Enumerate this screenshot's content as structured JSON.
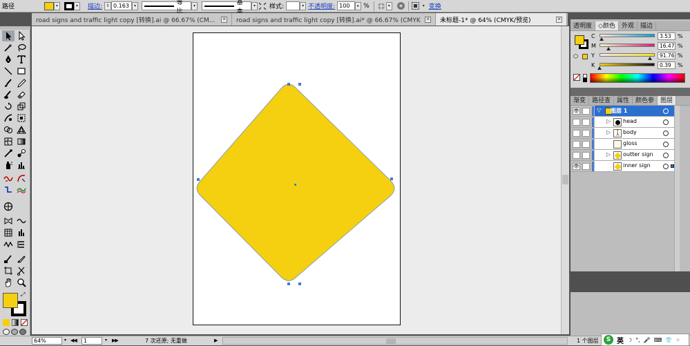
{
  "control_bar": {
    "object_type": "路径",
    "stroke_label": "描边:",
    "stroke_weight": "0.163",
    "uniform_label": "等比",
    "brush_label": "基本",
    "style_label": "样式:",
    "opacity_label": "不透明度:",
    "opacity_value": "100",
    "opacity_unit": "%",
    "transform_label": "变换",
    "fill_color": "#f5d010"
  },
  "tabs": [
    {
      "label": "road signs and traffic light copy [转换].ai @ 66.67% (CM...",
      "active": false
    },
    {
      "label": "road signs and traffic light copy [转换].ai* @ 66.67% (CMYK...",
      "active": false
    },
    {
      "label": "未标题-1* @ 64% (CMYK/预览)",
      "active": true
    }
  ],
  "color_panel": {
    "tabs": [
      "透明度",
      "◇颜色",
      "外观",
      "描边"
    ],
    "active_tab": 1,
    "sliders": [
      {
        "channel": "C",
        "value": "3.53",
        "fraction": 0.0353
      },
      {
        "channel": "M",
        "value": "16.47",
        "fraction": 0.1647
      },
      {
        "channel": "Y",
        "value": "91.76",
        "fraction": 0.9176
      },
      {
        "channel": "K",
        "value": "0.39",
        "fraction": 0.0039
      }
    ],
    "unit": "%"
  },
  "layers_panel": {
    "tabs": [
      "渐变",
      "路径查",
      "属性",
      "颜色参",
      "图层"
    ],
    "active_tab": 4,
    "layers": [
      {
        "name": "图层 1",
        "level": 0,
        "selected": true,
        "visible": true
      },
      {
        "name": "head",
        "level": 1,
        "selected": false,
        "visible": false
      },
      {
        "name": "body",
        "level": 1,
        "selected": false,
        "visible": false
      },
      {
        "name": "gloss",
        "level": 1,
        "selected": false,
        "visible": false
      },
      {
        "name": "outter sign",
        "level": 1,
        "selected": false,
        "visible": false
      },
      {
        "name": "inner sign",
        "level": 1,
        "selected": false,
        "visible": true
      }
    ]
  },
  "status_bar": {
    "zoom": "64%",
    "page": "1",
    "status_text": "7 次还原; 无重做",
    "layer_count": "1 个图层",
    "ime_label": "英"
  }
}
